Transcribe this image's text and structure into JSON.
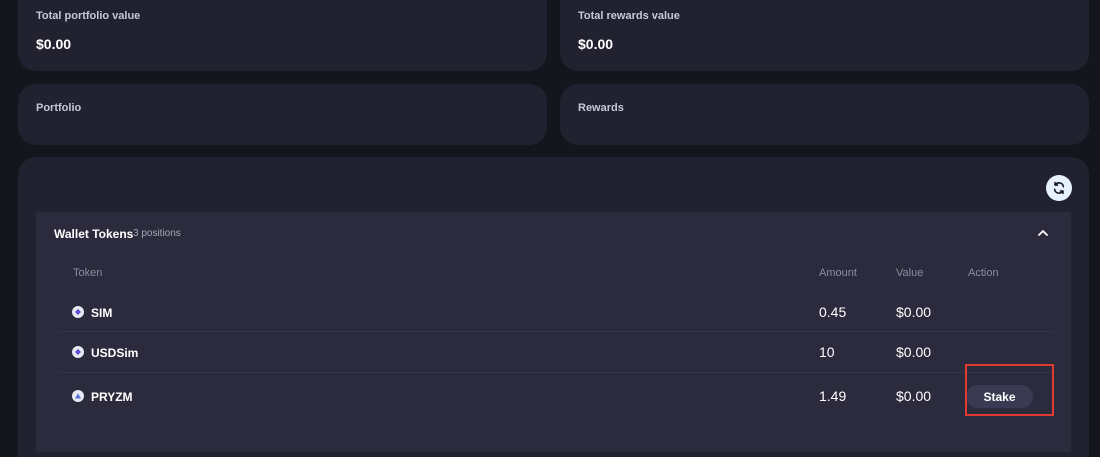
{
  "summary": {
    "total_portfolio_label": "Total portfolio value",
    "total_portfolio_value": "$0.00",
    "total_rewards_label": "Total rewards value",
    "total_rewards_value": "$0.00"
  },
  "sections": {
    "portfolio_label": "Portfolio",
    "rewards_label": "Rewards"
  },
  "wallet_tokens": {
    "title": "Wallet Tokens",
    "count": "3 positions",
    "columns": {
      "token": "Token",
      "amount": "Amount",
      "value": "Value",
      "action": "Action"
    },
    "rows": [
      {
        "token": "SIM",
        "amount": "0.45",
        "value": "$0.00",
        "action": ""
      },
      {
        "token": "USDSim",
        "amount": "10",
        "value": "$0.00",
        "action": ""
      },
      {
        "token": "PRYZM",
        "amount": "1.49",
        "value": "$0.00",
        "action": "Stake"
      }
    ]
  },
  "icons": {
    "refresh": "refresh-icon",
    "collapse": "chevron-up-icon",
    "token": "token-icon"
  },
  "colors": {
    "background": "#15151d",
    "card": "#212130",
    "panel": "#2b2b3d",
    "highlight": "#e03a32",
    "refresh_button": "#e6f0ff"
  }
}
